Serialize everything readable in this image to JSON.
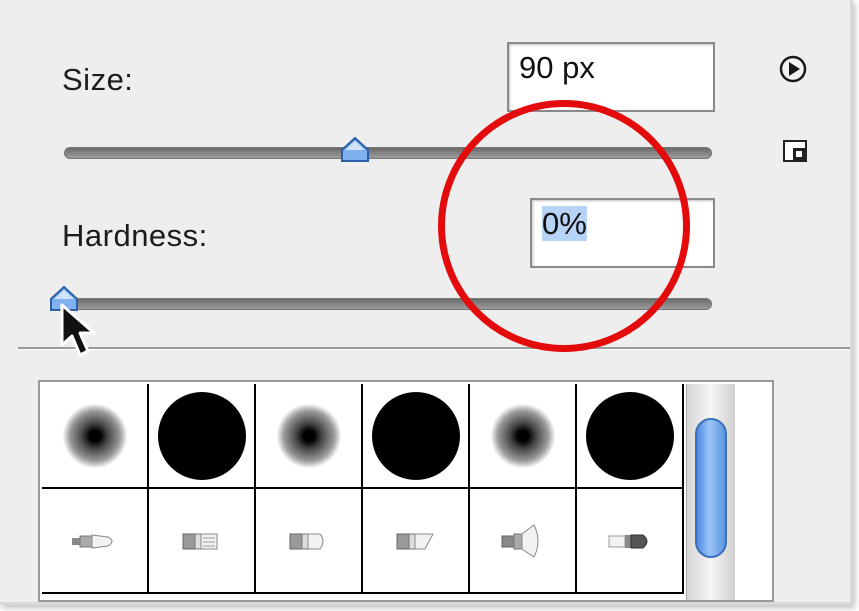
{
  "size": {
    "label": "Size:",
    "value": "90 px",
    "slider_fraction": 0.45
  },
  "hardness": {
    "label": "Hardness:",
    "value": "0%",
    "slider_fraction": 0.0
  },
  "menu_icon": "play-circle-icon",
  "new_preset_icon": "new-preset-icon",
  "presets": {
    "row1": [
      "soft-round",
      "hard-round",
      "soft-round",
      "hard-round",
      "soft-round",
      "hard-round"
    ],
    "row2": [
      "brush-tip-1",
      "brush-tip-2",
      "brush-tip-3",
      "brush-tip-4",
      "brush-tip-5",
      "brush-tip-6"
    ]
  },
  "colors": {
    "highlight": "#e30b0b",
    "selection": "#b7d3f5",
    "accent": "#4d8be0"
  }
}
